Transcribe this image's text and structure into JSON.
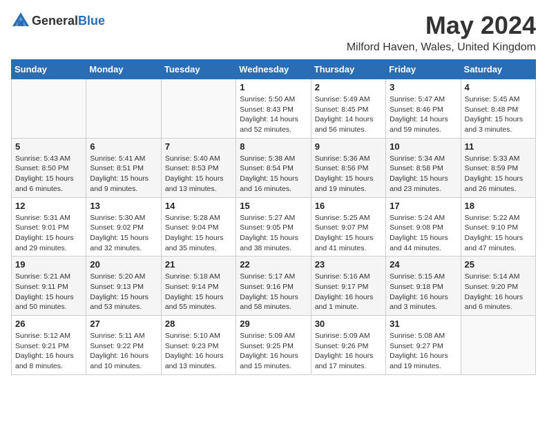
{
  "logo": {
    "text_general": "General",
    "text_blue": "Blue"
  },
  "title": "May 2024",
  "location": "Milford Haven, Wales, United Kingdom",
  "weekdays": [
    "Sunday",
    "Monday",
    "Tuesday",
    "Wednesday",
    "Thursday",
    "Friday",
    "Saturday"
  ],
  "weeks": [
    [
      {
        "day": "",
        "info": ""
      },
      {
        "day": "",
        "info": ""
      },
      {
        "day": "",
        "info": ""
      },
      {
        "day": "1",
        "info": "Sunrise: 5:50 AM\nSunset: 8:43 PM\nDaylight: 14 hours and 52 minutes."
      },
      {
        "day": "2",
        "info": "Sunrise: 5:49 AM\nSunset: 8:45 PM\nDaylight: 14 hours and 56 minutes."
      },
      {
        "day": "3",
        "info": "Sunrise: 5:47 AM\nSunset: 8:46 PM\nDaylight: 14 hours and 59 minutes."
      },
      {
        "day": "4",
        "info": "Sunrise: 5:45 AM\nSunset: 8:48 PM\nDaylight: 15 hours and 3 minutes."
      }
    ],
    [
      {
        "day": "5",
        "info": "Sunrise: 5:43 AM\nSunset: 8:50 PM\nDaylight: 15 hours and 6 minutes."
      },
      {
        "day": "6",
        "info": "Sunrise: 5:41 AM\nSunset: 8:51 PM\nDaylight: 15 hours and 9 minutes."
      },
      {
        "day": "7",
        "info": "Sunrise: 5:40 AM\nSunset: 8:53 PM\nDaylight: 15 hours and 13 minutes."
      },
      {
        "day": "8",
        "info": "Sunrise: 5:38 AM\nSunset: 8:54 PM\nDaylight: 15 hours and 16 minutes."
      },
      {
        "day": "9",
        "info": "Sunrise: 5:36 AM\nSunset: 8:56 PM\nDaylight: 15 hours and 19 minutes."
      },
      {
        "day": "10",
        "info": "Sunrise: 5:34 AM\nSunset: 8:58 PM\nDaylight: 15 hours and 23 minutes."
      },
      {
        "day": "11",
        "info": "Sunrise: 5:33 AM\nSunset: 8:59 PM\nDaylight: 15 hours and 26 minutes."
      }
    ],
    [
      {
        "day": "12",
        "info": "Sunrise: 5:31 AM\nSunset: 9:01 PM\nDaylight: 15 hours and 29 minutes."
      },
      {
        "day": "13",
        "info": "Sunrise: 5:30 AM\nSunset: 9:02 PM\nDaylight: 15 hours and 32 minutes."
      },
      {
        "day": "14",
        "info": "Sunrise: 5:28 AM\nSunset: 9:04 PM\nDaylight: 15 hours and 35 minutes."
      },
      {
        "day": "15",
        "info": "Sunrise: 5:27 AM\nSunset: 9:05 PM\nDaylight: 15 hours and 38 minutes."
      },
      {
        "day": "16",
        "info": "Sunrise: 5:25 AM\nSunset: 9:07 PM\nDaylight: 15 hours and 41 minutes."
      },
      {
        "day": "17",
        "info": "Sunrise: 5:24 AM\nSunset: 9:08 PM\nDaylight: 15 hours and 44 minutes."
      },
      {
        "day": "18",
        "info": "Sunrise: 5:22 AM\nSunset: 9:10 PM\nDaylight: 15 hours and 47 minutes."
      }
    ],
    [
      {
        "day": "19",
        "info": "Sunrise: 5:21 AM\nSunset: 9:11 PM\nDaylight: 15 hours and 50 minutes."
      },
      {
        "day": "20",
        "info": "Sunrise: 5:20 AM\nSunset: 9:13 PM\nDaylight: 15 hours and 53 minutes."
      },
      {
        "day": "21",
        "info": "Sunrise: 5:18 AM\nSunset: 9:14 PM\nDaylight: 15 hours and 55 minutes."
      },
      {
        "day": "22",
        "info": "Sunrise: 5:17 AM\nSunset: 9:16 PM\nDaylight: 15 hours and 58 minutes."
      },
      {
        "day": "23",
        "info": "Sunrise: 5:16 AM\nSunset: 9:17 PM\nDaylight: 16 hours and 1 minute."
      },
      {
        "day": "24",
        "info": "Sunrise: 5:15 AM\nSunset: 9:18 PM\nDaylight: 16 hours and 3 minutes."
      },
      {
        "day": "25",
        "info": "Sunrise: 5:14 AM\nSunset: 9:20 PM\nDaylight: 16 hours and 6 minutes."
      }
    ],
    [
      {
        "day": "26",
        "info": "Sunrise: 5:12 AM\nSunset: 9:21 PM\nDaylight: 16 hours and 8 minutes."
      },
      {
        "day": "27",
        "info": "Sunrise: 5:11 AM\nSunset: 9:22 PM\nDaylight: 16 hours and 10 minutes."
      },
      {
        "day": "28",
        "info": "Sunrise: 5:10 AM\nSunset: 9:23 PM\nDaylight: 16 hours and 13 minutes."
      },
      {
        "day": "29",
        "info": "Sunrise: 5:09 AM\nSunset: 9:25 PM\nDaylight: 16 hours and 15 minutes."
      },
      {
        "day": "30",
        "info": "Sunrise: 5:09 AM\nSunset: 9:26 PM\nDaylight: 16 hours and 17 minutes."
      },
      {
        "day": "31",
        "info": "Sunrise: 5:08 AM\nSunset: 9:27 PM\nDaylight: 16 hours and 19 minutes."
      },
      {
        "day": "",
        "info": ""
      }
    ]
  ]
}
